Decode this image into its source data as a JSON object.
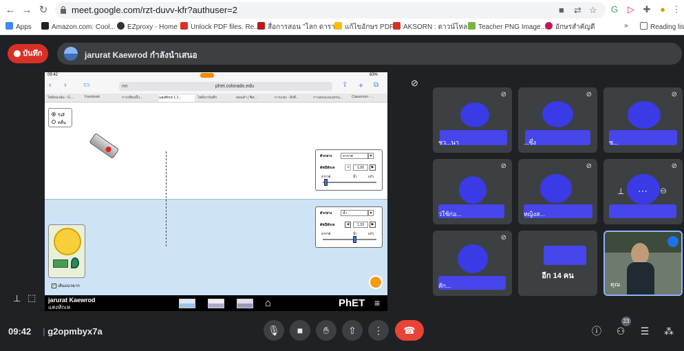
{
  "browser": {
    "url": "meet.google.com/rzt-duvv-kfr?authuser=2",
    "bookmarks": [
      "Apps",
      "Amazon.com: Cool...",
      "EZproxy - Home",
      "Unlock PDF files. Re...",
      "สื่อการสอน \"โลก ดารา...",
      "แก้ไขอักษร PDF",
      "AKSORN : ดาวน์โหล...",
      "Teacher PNG Image...",
      "อักษรสำคัญดี",
      "»",
      "Reading list"
    ]
  },
  "meet": {
    "record_label": "บันทึก",
    "presenter_text": "jarurat Kaewrod กำลังนำเสนอ",
    "time": "09:42",
    "meeting_code": "g2opmbyx7a",
    "participant_count": "23",
    "more_label": "อีก 14 คน",
    "self_name": "คุณ",
    "tiles": [
      {
        "name": "ชว...นา"
      },
      {
        "name": "...ซึ่ง"
      },
      {
        "name": "ช..."
      },
      {
        "name": "ว่ใช้ก่อ..."
      },
      {
        "name": "หญิงส..."
      },
      {
        "name": ""
      },
      {
        "name": "สัก..."
      }
    ]
  },
  "ipad": {
    "status_time": "09:42",
    "battery": "83%",
    "tab_field": "กก",
    "address": "phet.colorado.edu",
    "tabs": [
      "ไฟล์ของฉัน - G...",
      "Facebook",
      "การเขียนนิ้ว...",
      "แสงหักเห 1.1...",
      "ไฟล์นาบันทึก",
      "สอนคำ | ฟิส...",
      "การแข่ง - สิ่งที่...",
      "การสอนแบบเทรน...",
      "Classroom - ..."
    ]
  },
  "sim": {
    "ray_option": "รังสี",
    "wave_option": "คลื่น",
    "top_panel": {
      "medium_label": "ตัวกลาง",
      "medium_value": "อากาศ",
      "index_label": "ดัชนีหักเห",
      "index_value": "1.00",
      "scale_left": "อากาศ",
      "scale_mid": "น้ำ",
      "scale_right": "แก้ว"
    },
    "bottom_panel": {
      "medium_label": "ตัวกลาง",
      "medium_value": "น้ำ",
      "index_label": "ดัชนีหักเห",
      "index_value": "1.33",
      "scale_left": "อากาศ",
      "scale_mid": "น้ำ",
      "scale_right": "แก้ว"
    },
    "normal_label": "เส้นแนวฉาก",
    "footer_name": "jarurat Kaewrod",
    "footer_title": "แสงหักเห",
    "logo": "PhET"
  }
}
